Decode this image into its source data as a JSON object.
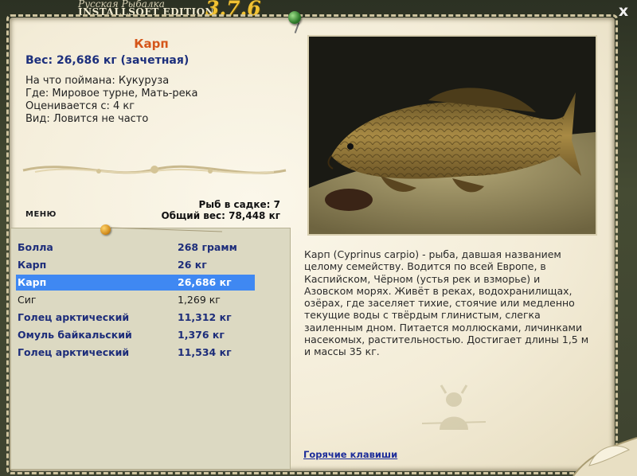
{
  "window": {
    "subtitle": "Русская Рыбалка",
    "edition": "INSTALLSOFT EDITION",
    "version": "3.7.6",
    "close_glyph": "x"
  },
  "fish": {
    "name": "Карп",
    "weight": "Вес: 26,686 кг (зачетная)",
    "bait": "На что поймана: Кукуруза",
    "place": "Где: Мировое турне, Мать-река",
    "rated_from": "Оценивается с: 4 кг",
    "kind": "Вид: Ловится не часто"
  },
  "cage": {
    "count": "Рыб в садке: 7",
    "total_weight": "Общий вес: 78,448 кг"
  },
  "menu": {
    "label": "МЕНЮ"
  },
  "catch_list": [
    {
      "name": "Болла",
      "weight": "268 грамм",
      "style": "bold"
    },
    {
      "name": "Карп",
      "weight": "26 кг",
      "style": "bold"
    },
    {
      "name": "Карп",
      "weight": "26,686 кг",
      "style": "selected"
    },
    {
      "name": "Сиг",
      "weight": "1,269 кг",
      "style": "plain"
    },
    {
      "name": "Голец арктический",
      "weight": "11,312 кг",
      "style": "bold"
    },
    {
      "name": "Омуль байкальский",
      "weight": "1,376 кг",
      "style": "bold"
    },
    {
      "name": "Голец арктический",
      "weight": "11,534 кг",
      "style": "bold"
    }
  ],
  "description": "Карп (Cyprinus carpio) - рыба, давшая названием целому семейству. Водится по всей Европе, в Каспийском, Чёрном (устья рек и взморье) и Азовском морях. Живёт в реках, водохранилищах, озёрах, где заселяет тихие, стоячие или медленно текущие воды с твёрдым глинистым, слегка заиленным дном. Питается моллюсками, личинками насекомых, растительностью. Достигает длины 1,5 м и массы 35 кг.",
  "hotkeys": {
    "label": "Горячие клавиши"
  },
  "colors": {
    "accent_orange": "#d5561a",
    "accent_blue": "#1c2f7c",
    "selection": "#3f88f2",
    "version_gold": "#f1c233"
  },
  "icons": {
    "pin": "green-pushpin-icon",
    "catch_pin": "orange-pushpin-icon",
    "photo": "carp-photo",
    "watermark": "fisherman-silhouette-icon"
  }
}
